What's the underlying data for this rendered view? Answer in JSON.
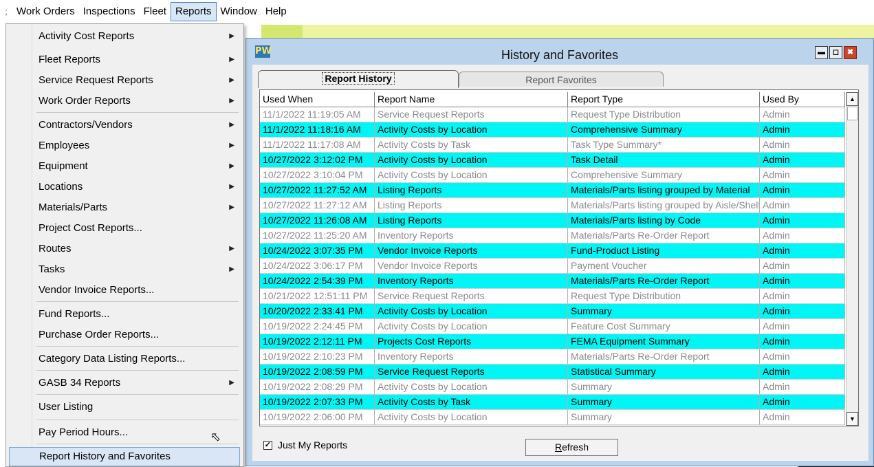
{
  "menubar": {
    "items": [
      "Work Orders",
      "Inspections",
      "Fleet",
      "Reports",
      "Window",
      "Help"
    ],
    "active": "Reports"
  },
  "reports_menu": {
    "items": [
      {
        "label": "Activity Cost Reports",
        "submenu": true
      },
      {
        "label": "Fleet Reports",
        "submenu": true
      },
      {
        "label": "Service Request Reports",
        "submenu": true
      },
      {
        "label": "Work Order Reports",
        "submenu": true
      },
      {
        "label": "Contractors/Vendors",
        "submenu": true
      },
      {
        "label": "Employees",
        "submenu": true
      },
      {
        "label": "Equipment",
        "submenu": true
      },
      {
        "label": "Locations",
        "submenu": true
      },
      {
        "label": "Materials/Parts",
        "submenu": true
      },
      {
        "label": "Project Cost Reports...",
        "submenu": false
      },
      {
        "label": "Routes",
        "submenu": true
      },
      {
        "label": "Tasks",
        "submenu": true
      },
      {
        "label": "Vendor Invoice Reports...",
        "submenu": false
      },
      {
        "label": "Fund Reports...",
        "submenu": false
      },
      {
        "label": "Purchase Order Reports...",
        "submenu": false
      },
      {
        "label": "Category Data Listing Reports...",
        "submenu": false
      },
      {
        "label": "GASB 34 Reports",
        "submenu": true
      },
      {
        "label": "User Listing",
        "submenu": false
      },
      {
        "label": "Pay Period Hours...",
        "submenu": false
      },
      {
        "label": "Report History and Favorites",
        "submenu": false,
        "hovered": true
      }
    ]
  },
  "dialog": {
    "title": "History and Favorites",
    "icon_text": "PW",
    "tabs": [
      {
        "label": "Report History",
        "active": true
      },
      {
        "label": "Report Favorites",
        "active": false
      }
    ],
    "columns": [
      "Used When",
      "Report Name",
      "Report Type",
      "Used By"
    ],
    "rows": [
      {
        "used_when": "11/1/2022 11:19:05 AM",
        "report_name": "Service Request Reports",
        "report_type": "Request Type Distribution",
        "used_by": "Admin",
        "highlighted": false
      },
      {
        "used_when": "11/1/2022 11:18:16 AM",
        "report_name": "Activity Costs by Location",
        "report_type": "Comprehensive Summary",
        "used_by": "Admin",
        "highlighted": true
      },
      {
        "used_when": "11/1/2022 11:17:08 AM",
        "report_name": "Activity Costs by Task",
        "report_type": "Task Type Summary*",
        "used_by": "Admin",
        "highlighted": false
      },
      {
        "used_when": "10/27/2022 3:12:02 PM",
        "report_name": "Activity Costs by Location",
        "report_type": "Task Detail",
        "used_by": "Admin",
        "highlighted": true
      },
      {
        "used_when": "10/27/2022 3:10:04 PM",
        "report_name": "Activity Costs by Location",
        "report_type": "Comprehensive Summary",
        "used_by": "Admin",
        "highlighted": false
      },
      {
        "used_when": "10/27/2022 11:27:52 AM",
        "report_name": "Listing Reports",
        "report_type": "Materials/Parts listing grouped by Material",
        "used_by": "Admin",
        "highlighted": true
      },
      {
        "used_when": "10/27/2022 11:27:12 AM",
        "report_name": "Listing Reports",
        "report_type": "Materials/Parts listing grouped by Aisle/Shelf",
        "used_by": "Admin",
        "highlighted": false
      },
      {
        "used_when": "10/27/2022 11:26:08 AM",
        "report_name": "Listing Reports",
        "report_type": "Materials/Parts listing by Code",
        "used_by": "Admin",
        "highlighted": true
      },
      {
        "used_when": "10/27/2022 11:25:20 AM",
        "report_name": " Inventory Reports",
        "report_type": "Materials/Parts Re-Order Report",
        "used_by": "Admin",
        "highlighted": false
      },
      {
        "used_when": "10/24/2022 3:07:35 PM",
        "report_name": "Vendor Invoice Reports",
        "report_type": "Fund-Product Listing",
        "used_by": "Admin",
        "highlighted": true
      },
      {
        "used_when": "10/24/2022 3:06:17 PM",
        "report_name": "Vendor Invoice Reports",
        "report_type": "Payment Voucher",
        "used_by": "Admin",
        "highlighted": false
      },
      {
        "used_when": "10/24/2022 2:54:39 PM",
        "report_name": " Inventory Reports",
        "report_type": "Materials/Parts Re-Order Report",
        "used_by": "Admin",
        "highlighted": true
      },
      {
        "used_when": "10/21/2022 12:51:11 PM",
        "report_name": "Service Request Reports",
        "report_type": "Request Type Distribution",
        "used_by": "Admin",
        "highlighted": false
      },
      {
        "used_when": "10/20/2022 2:33:41 PM",
        "report_name": "Activity Costs by Location",
        "report_type": "Summary",
        "used_by": "Admin",
        "highlighted": true
      },
      {
        "used_when": "10/19/2022 2:24:45 PM",
        "report_name": "Activity Costs by Location",
        "report_type": "Feature Cost Summary",
        "used_by": "Admin",
        "highlighted": false
      },
      {
        "used_when": "10/19/2022 2:12:11 PM",
        "report_name": "Projects Cost Reports",
        "report_type": "FEMA Equipment Summary",
        "used_by": "Admin",
        "highlighted": true
      },
      {
        "used_when": "10/19/2022 2:10:23 PM",
        "report_name": " Inventory Reports",
        "report_type": "Materials/Parts Re-Order Report",
        "used_by": "Admin",
        "highlighted": false
      },
      {
        "used_when": "10/19/2022 2:08:59 PM",
        "report_name": "Service Request Reports",
        "report_type": "Statistical Summary",
        "used_by": "Admin",
        "highlighted": true
      },
      {
        "used_when": "10/19/2022 2:08:29 PM",
        "report_name": "Activity Costs by Location",
        "report_type": "Summary",
        "used_by": "Admin",
        "highlighted": false
      },
      {
        "used_when": "10/19/2022 2:07:33 PM",
        "report_name": "Activity Costs by Task",
        "report_type": "Summary",
        "used_by": "Admin",
        "highlighted": true
      },
      {
        "used_when": "10/19/2022 2:06:00 PM",
        "report_name": "Activity Costs by Location",
        "report_type": "Summary",
        "used_by": "Admin",
        "highlighted": false
      }
    ],
    "just_my_reports_label": "Just My Reports",
    "just_my_reports_checked": true,
    "refresh_label": "Refresh"
  },
  "colors": {
    "highlight_row": "#00f5f5",
    "dialog_frame": "#bcd3ec",
    "menu_hover": "#d8e6f6"
  }
}
